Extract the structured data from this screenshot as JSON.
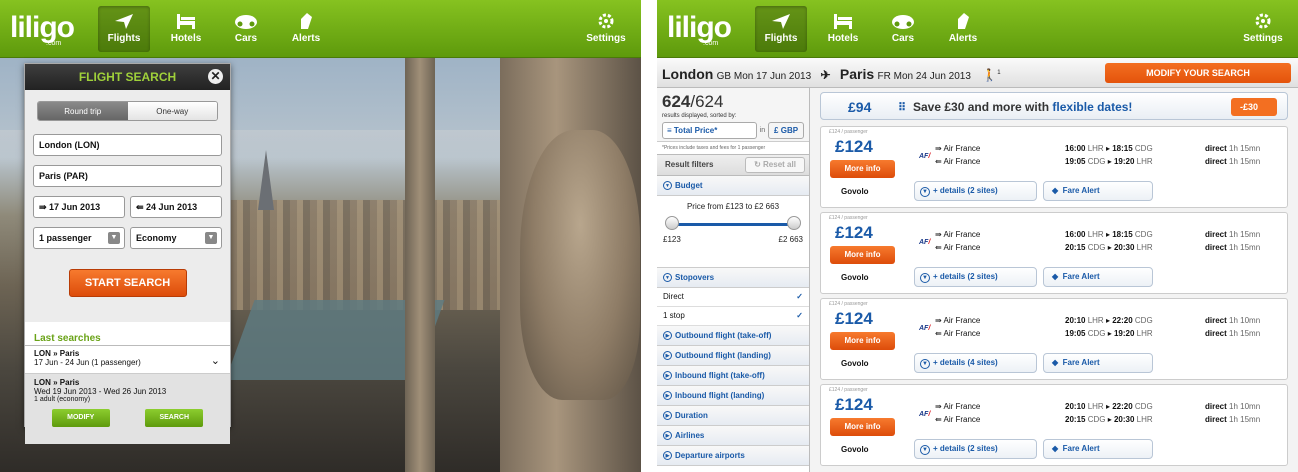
{
  "app": {
    "logo": "liligo",
    "logo_sub": ".com"
  },
  "nav": {
    "flights": "Flights",
    "hotels": "Hotels",
    "cars": "Cars",
    "alerts": "Alerts",
    "settings": "Settings"
  },
  "search_panel": {
    "title": "FLIGHT SEARCH",
    "trip_round": "Round trip",
    "trip_oneway": "One-way",
    "from": "London (LON)",
    "to": "Paris (PAR)",
    "depart_date": "17 Jun 2013",
    "return_date": "24 Jun 2013",
    "passengers": "1 passenger",
    "cabin": "Economy",
    "start_button": "START SEARCH"
  },
  "last_searches": {
    "title": "Last searches",
    "items": [
      {
        "route": "LON » Paris",
        "detail": "17 Jun - 24 Jun (1 passenger)"
      },
      {
        "route": "LON » Paris",
        "detail": "Wed 19 Jun 2013 - Wed 26 Jun 2013",
        "pax": "1 adult (economy)"
      }
    ],
    "modify": "MODIFY",
    "search": "SEARCH"
  },
  "route_bar": {
    "from_city": "London",
    "from_info": "GB Mon 17 Jun 2013",
    "to_city": "Paris",
    "to_info": "FR Mon 24 Jun 2013",
    "pax_count": "1",
    "modify_button": "MODIFY YOUR SEARCH"
  },
  "results": {
    "shown": "624",
    "total": "/624",
    "subtitle": "results displayed, sorted by:",
    "sort": "Total Price*",
    "in_label": "in",
    "currency": "£ GBP",
    "note": "*Prices include taxes and fees for 1 passenger"
  },
  "filters": {
    "title": "Result filters",
    "reset": "Reset all",
    "budget": "Budget",
    "price_range_text": "Price from £123 to £2 663",
    "min": "£123",
    "max": "£2 663",
    "stopovers": "Stopovers",
    "direct": "Direct",
    "one_stop": "1 stop",
    "others": [
      "Outbound flight (take-off)",
      "Outbound flight (landing)",
      "Inbound flight (take-off)",
      "Inbound flight (landing)",
      "Duration",
      "Airlines",
      "Departure airports"
    ]
  },
  "flexible": {
    "price": "£94",
    "text_a": "Save £30 and more with ",
    "text_b": "flexible dates!",
    "tag": "-£30"
  },
  "cards": [
    {
      "pp": "£124 / passenger",
      "price": "£124",
      "more": "More info",
      "site": "Govolo",
      "details": "+ details (2 sites)",
      "alert": "Fare Alert",
      "legs": [
        {
          "airline": "Air France",
          "dep": "16:00",
          "dep_ap": "LHR",
          "arr": "18:15",
          "arr_ap": "CDG",
          "type": "direct",
          "dur": "1h 15mn"
        },
        {
          "airline": "Air France",
          "dep": "19:05",
          "dep_ap": "CDG",
          "arr": "19:20",
          "arr_ap": "LHR",
          "type": "direct",
          "dur": "1h 15mn"
        }
      ]
    },
    {
      "pp": "£124 / passenger",
      "price": "£124",
      "more": "More info",
      "site": "Govolo",
      "details": "+ details (2 sites)",
      "alert": "Fare Alert",
      "legs": [
        {
          "airline": "Air France",
          "dep": "16:00",
          "dep_ap": "LHR",
          "arr": "18:15",
          "arr_ap": "CDG",
          "type": "direct",
          "dur": "1h 15mn"
        },
        {
          "airline": "Air France",
          "dep": "20:15",
          "dep_ap": "CDG",
          "arr": "20:30",
          "arr_ap": "LHR",
          "type": "direct",
          "dur": "1h 15mn"
        }
      ]
    },
    {
      "pp": "£124 / passenger",
      "price": "£124",
      "more": "More info",
      "site": "Govolo",
      "details": "+ details (4 sites)",
      "alert": "Fare Alert",
      "legs": [
        {
          "airline": "Air France",
          "dep": "20:10",
          "dep_ap": "LHR",
          "arr": "22:20",
          "arr_ap": "CDG",
          "type": "direct",
          "dur": "1h 10mn"
        },
        {
          "airline": "Air France",
          "dep": "19:05",
          "dep_ap": "CDG",
          "arr": "19:20",
          "arr_ap": "LHR",
          "type": "direct",
          "dur": "1h 15mn"
        }
      ]
    },
    {
      "pp": "£124 / passenger",
      "price": "£124",
      "more": "More info",
      "site": "Govolo",
      "details": "+ details (2 sites)",
      "alert": "Fare Alert",
      "legs": [
        {
          "airline": "Air France",
          "dep": "20:10",
          "dep_ap": "LHR",
          "arr": "22:20",
          "arr_ap": "CDG",
          "type": "direct",
          "dur": "1h 10mn"
        },
        {
          "airline": "Air France",
          "dep": "20:15",
          "dep_ap": "CDG",
          "arr": "20:30",
          "arr_ap": "LHR",
          "type": "direct",
          "dur": "1h 15mn"
        }
      ]
    }
  ],
  "airline_logo": "AF",
  "colors": {
    "brand_green": "#6aa318",
    "accent_orange": "#f36f21",
    "link_blue": "#1a5aa8"
  }
}
